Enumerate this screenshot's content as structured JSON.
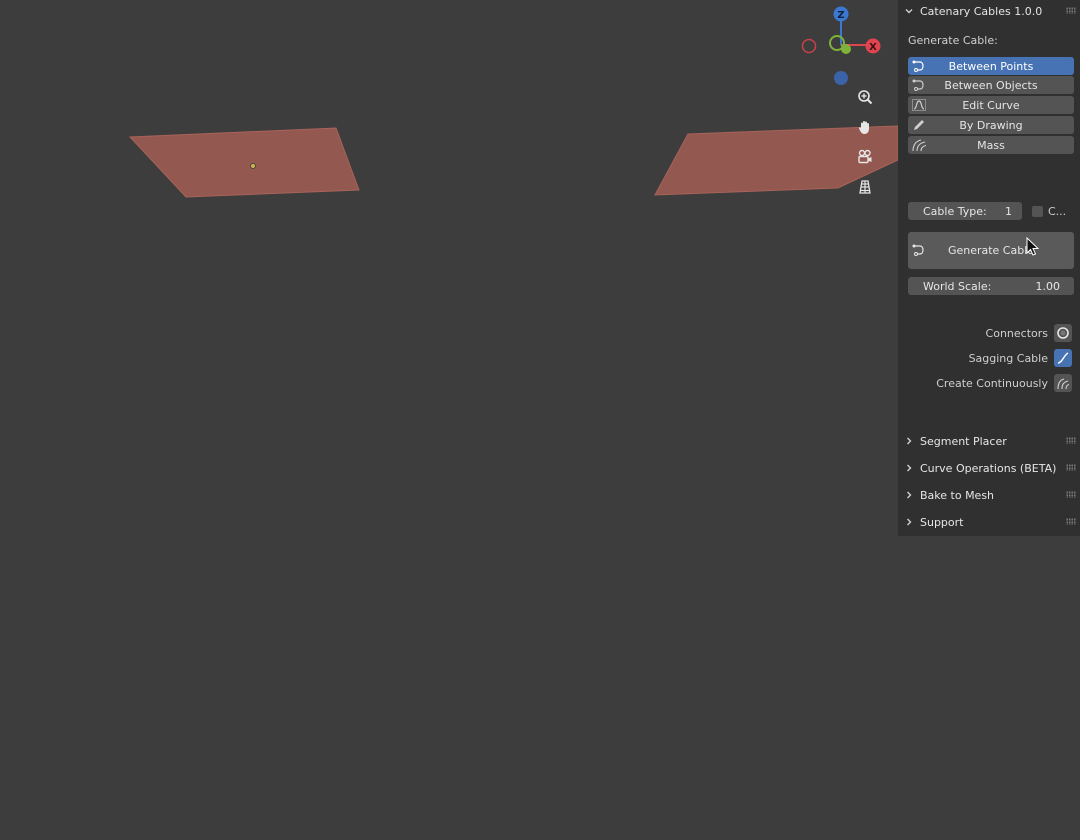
{
  "viewport": {
    "gizmo": {
      "z_label": "Z",
      "x_label": "X"
    },
    "nav_icons": [
      "zoom-icon",
      "pan-hand-icon",
      "camera-view-icon",
      "ortho-grid-icon"
    ]
  },
  "sidebar": {
    "main_panel": {
      "title": "Catenary Cables 1.0.0",
      "generate_label": "Generate Cable:",
      "modes": [
        {
          "label": "Between Points",
          "icon": "cable-points-icon",
          "active": true
        },
        {
          "label": "Between Objects",
          "icon": "cable-objects-icon",
          "active": false
        },
        {
          "label": "Edit Curve",
          "icon": "edit-curve-icon",
          "active": false
        },
        {
          "label": "By Drawing",
          "icon": "pencil-icon",
          "active": false
        },
        {
          "label": "Mass",
          "icon": "mass-icon",
          "active": false
        }
      ],
      "cable_type_label": "Cable Type:",
      "cable_type_value": "1",
      "checkbox_label": "C...",
      "generate_button": "Generate Cable",
      "world_scale_label": "World Scale:",
      "world_scale_value": "1.00",
      "toggles": [
        {
          "label": "Connectors",
          "icon": "ring-icon",
          "on": false
        },
        {
          "label": "Sagging Cable",
          "icon": "sag-curve-icon",
          "on": true
        },
        {
          "label": "Create Continuously",
          "icon": "continuous-icon",
          "on": false
        }
      ]
    },
    "collapsed_panels": [
      "Segment Placer",
      "Curve Operations (BETA)",
      "Bake to Mesh",
      "Support"
    ]
  },
  "colors": {
    "viewport_bg": "#3d3d3d",
    "panel_bg": "#303030",
    "accent": "#4772b3",
    "plane_fill": "#935850",
    "axis_x": "#e0444f",
    "axis_y": "#7fb23a",
    "axis_z": "#3a78d2"
  }
}
